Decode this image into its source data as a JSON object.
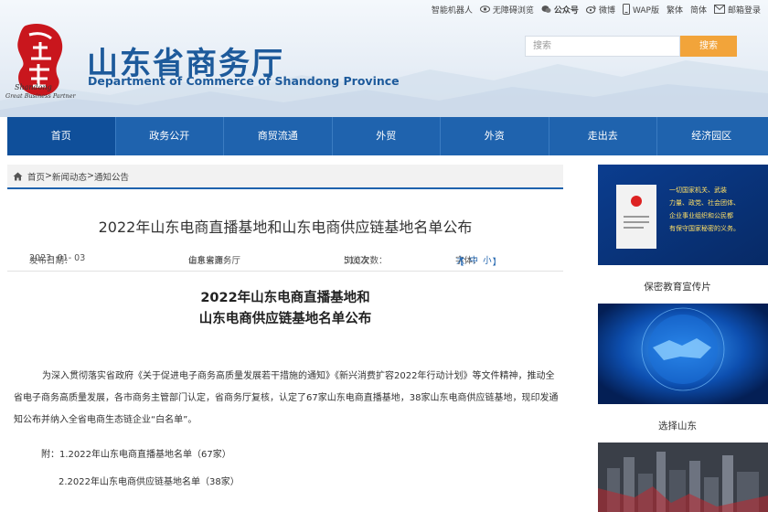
{
  "topbar": {
    "robot": "智能机器人",
    "accessible": "无障碍浏览",
    "wechat": "公众号",
    "weibo": "微博",
    "wap": "WAP版",
    "traditional": "繁体",
    "simplified": "简体",
    "mail": "邮箱登录"
  },
  "header": {
    "logo_en1": "Shandong",
    "logo_en2": "Great Business Partner",
    "title": "山东省商务厅",
    "subtitle": "Department of Commerce of Shandong Province",
    "search_placeholder": "搜索",
    "search_button": "搜索"
  },
  "nav": {
    "items": [
      "首页",
      "政务公开",
      "商贸流通",
      "外贸",
      "外资",
      "走出去",
      "经济园区"
    ],
    "active": 0
  },
  "breadcrumb": {
    "home": "首页",
    "sep1": ">",
    "section": "新闻动态",
    "sep2": ">",
    "page": "通知公告"
  },
  "article": {
    "title": "2022年山东电商直播基地和山东电商供应链基地名单公布",
    "date_label": "发布日期：",
    "date": "2023- 01- 03",
    "source_label": "信息来源：",
    "source": "山东省商务厅",
    "views_label": "浏览次数：",
    "views": "510次",
    "font_label": "字体：",
    "font_open": "【",
    "font_large": "大",
    "font_medium": "中",
    "font_small": "小",
    "font_close": "】",
    "doc_title_line1": "2022年山东电商直播基地和",
    "doc_title_line2": "山东电商供应链基地名单公布",
    "paragraph": "为深入贯彻落实省政府《关于促进电子商务高质量发展若干措施的通知》《新兴消费扩容2022年行动计划》等文件精神，推动全省电子商务高质量发展，各市商务主管部门认定，省商务厅复核，认定了67家山东电商直播基地，38家山东电商供应链基地，现印发通知公布并纳入全省电商生态链企业“白名单”。",
    "attachment1": "附：1.2022年山东电商直播基地名单（67家）",
    "attachment2": "2.2022年山东电商供应链基地名单（38家）"
  },
  "sidebar": {
    "banner1_text1": "一切国家机关、武装",
    "banner1_text2": "力量、政党、社会团体、",
    "banner1_text3": "企业事业组织和公民都",
    "banner1_text4": "有保守国家秘密的义务。",
    "caption1": "保密教育宣传片",
    "caption2": "选择山东"
  },
  "colors": {
    "brand_blue": "#1f63ae",
    "nav_active": "#0f4f9a",
    "search_orange": "#f2a43a",
    "title_blue": "#1d5a9b"
  }
}
